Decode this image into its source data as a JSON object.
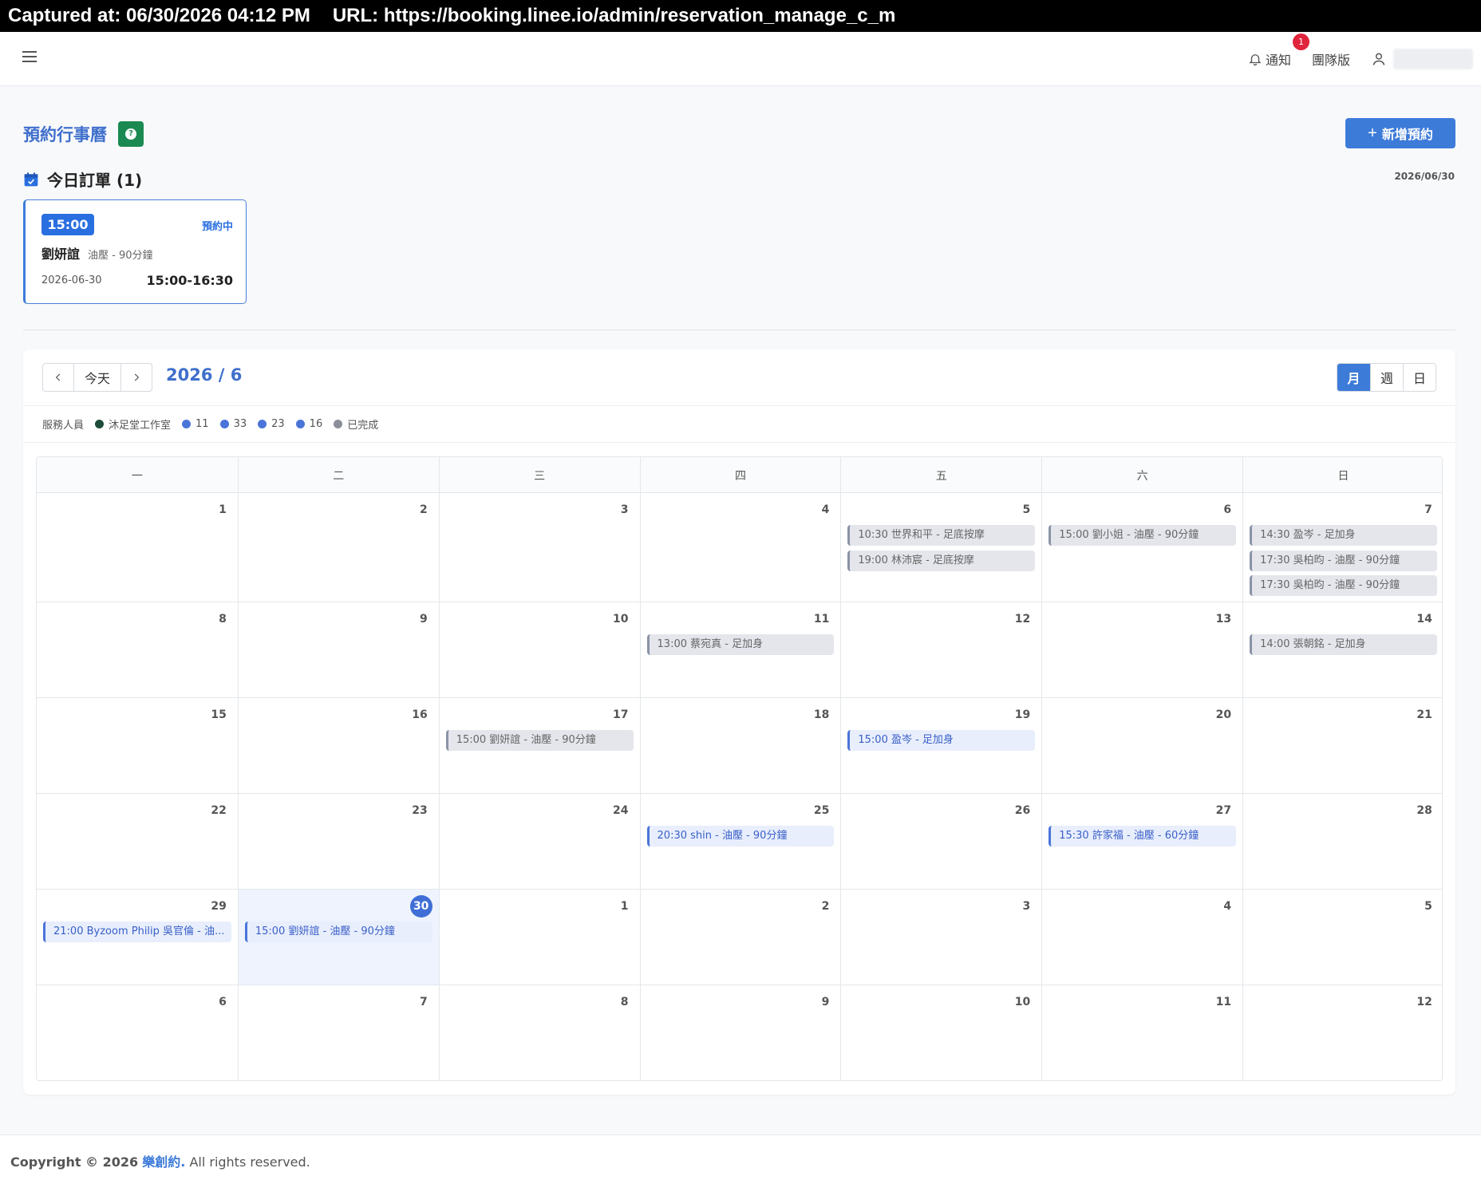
{
  "capture": {
    "captured_at": "Captured at: 06/30/2026 04:12 PM",
    "url": "URL: https://booking.linee.io/admin/reservation_manage_c_m"
  },
  "topnav": {
    "notify_label": "通知",
    "notify_count": "1",
    "team_label": "團隊版"
  },
  "page": {
    "title": "預約行事曆",
    "new_button": "新增預約",
    "help_mark": "?"
  },
  "today": {
    "heading": "今日訂單 (1)",
    "date": "2026/06/30",
    "order": {
      "time": "15:00",
      "status": "預約中",
      "name": "劉妍誼",
      "service": "油壓 - 90分鐘",
      "date": "2026-06-30",
      "range": "15:00-16:30"
    }
  },
  "calendar": {
    "today_button": "今天",
    "month_label": "2026 / 6",
    "views": [
      "月",
      "週",
      "日"
    ],
    "active_view": "月",
    "legend_label": "服務人員",
    "legend": [
      {
        "name": "沐足堂工作室",
        "color": "#1d4d3a"
      },
      {
        "name": "11",
        "color": "#4a74d8"
      },
      {
        "name": "33",
        "color": "#4a74d8"
      },
      {
        "name": "23",
        "color": "#4a74d8"
      },
      {
        "name": "16",
        "color": "#4a74d8"
      },
      {
        "name": "已完成",
        "color": "#8a8f99"
      }
    ],
    "weekdays": [
      "一",
      "二",
      "三",
      "四",
      "五",
      "六",
      "日"
    ],
    "weeks": [
      [
        {
          "day": "1",
          "events": []
        },
        {
          "day": "2",
          "events": []
        },
        {
          "day": "3",
          "events": []
        },
        {
          "day": "4",
          "events": []
        },
        {
          "day": "5",
          "events": [
            {
              "text": "10:30 世界和平 - 足底按摩",
              "state": "done"
            },
            {
              "text": "19:00 林沛宸 - 足底按摩",
              "state": "done"
            }
          ]
        },
        {
          "day": "6",
          "events": [
            {
              "text": "15:00 劉小姐 - 油壓 - 90分鐘",
              "state": "done"
            }
          ]
        },
        {
          "day": "7",
          "events": [
            {
              "text": "14:30 盈岑 - 足加身",
              "state": "done"
            },
            {
              "text": "17:30 吳柏昀 - 油壓 - 90分鐘",
              "state": "done"
            },
            {
              "text": "17:30 吳柏昀 - 油壓 - 90分鐘",
              "state": "done"
            }
          ]
        }
      ],
      [
        {
          "day": "8",
          "events": []
        },
        {
          "day": "9",
          "events": []
        },
        {
          "day": "10",
          "events": []
        },
        {
          "day": "11",
          "events": [
            {
              "text": "13:00 蔡宛真 - 足加身",
              "state": "done"
            }
          ]
        },
        {
          "day": "12",
          "events": []
        },
        {
          "day": "13",
          "events": []
        },
        {
          "day": "14",
          "events": [
            {
              "text": "14:00 張朝銘 - 足加身",
              "state": "done"
            }
          ]
        }
      ],
      [
        {
          "day": "15",
          "events": []
        },
        {
          "day": "16",
          "events": []
        },
        {
          "day": "17",
          "events": [
            {
              "text": "15:00 劉妍誼 - 油壓 - 90分鐘",
              "state": "done"
            }
          ]
        },
        {
          "day": "18",
          "events": []
        },
        {
          "day": "19",
          "events": [
            {
              "text": "15:00 盈岑 - 足加身",
              "state": "booked"
            }
          ]
        },
        {
          "day": "20",
          "events": []
        },
        {
          "day": "21",
          "events": []
        }
      ],
      [
        {
          "day": "22",
          "events": []
        },
        {
          "day": "23",
          "events": []
        },
        {
          "day": "24",
          "events": []
        },
        {
          "day": "25",
          "events": [
            {
              "text": "20:30 shin - 油壓 - 90分鐘",
              "state": "booked"
            }
          ]
        },
        {
          "day": "26",
          "events": []
        },
        {
          "day": "27",
          "events": [
            {
              "text": "15:30 許家福 - 油壓 - 60分鐘",
              "state": "booked"
            }
          ]
        },
        {
          "day": "28",
          "events": []
        }
      ],
      [
        {
          "day": "29",
          "events": [
            {
              "text": "21:00 Byzoom Philip 吳官倫 - 油...",
              "state": "booked"
            }
          ]
        },
        {
          "day": "30",
          "today": true,
          "events": [
            {
              "text": "15:00 劉妍誼 - 油壓 - 90分鐘",
              "state": "booked"
            }
          ]
        },
        {
          "day": "1",
          "events": []
        },
        {
          "day": "2",
          "events": []
        },
        {
          "day": "3",
          "events": []
        },
        {
          "day": "4",
          "events": []
        },
        {
          "day": "5",
          "events": []
        }
      ],
      [
        {
          "day": "6",
          "events": []
        },
        {
          "day": "7",
          "events": []
        },
        {
          "day": "8",
          "events": []
        },
        {
          "day": "9",
          "events": []
        },
        {
          "day": "10",
          "events": []
        },
        {
          "day": "11",
          "events": []
        },
        {
          "day": "12",
          "events": []
        }
      ]
    ]
  },
  "footer": {
    "prefix": "Copyright © 2026",
    "brand": "樂創約.",
    "suffix": "All rights reserved."
  }
}
